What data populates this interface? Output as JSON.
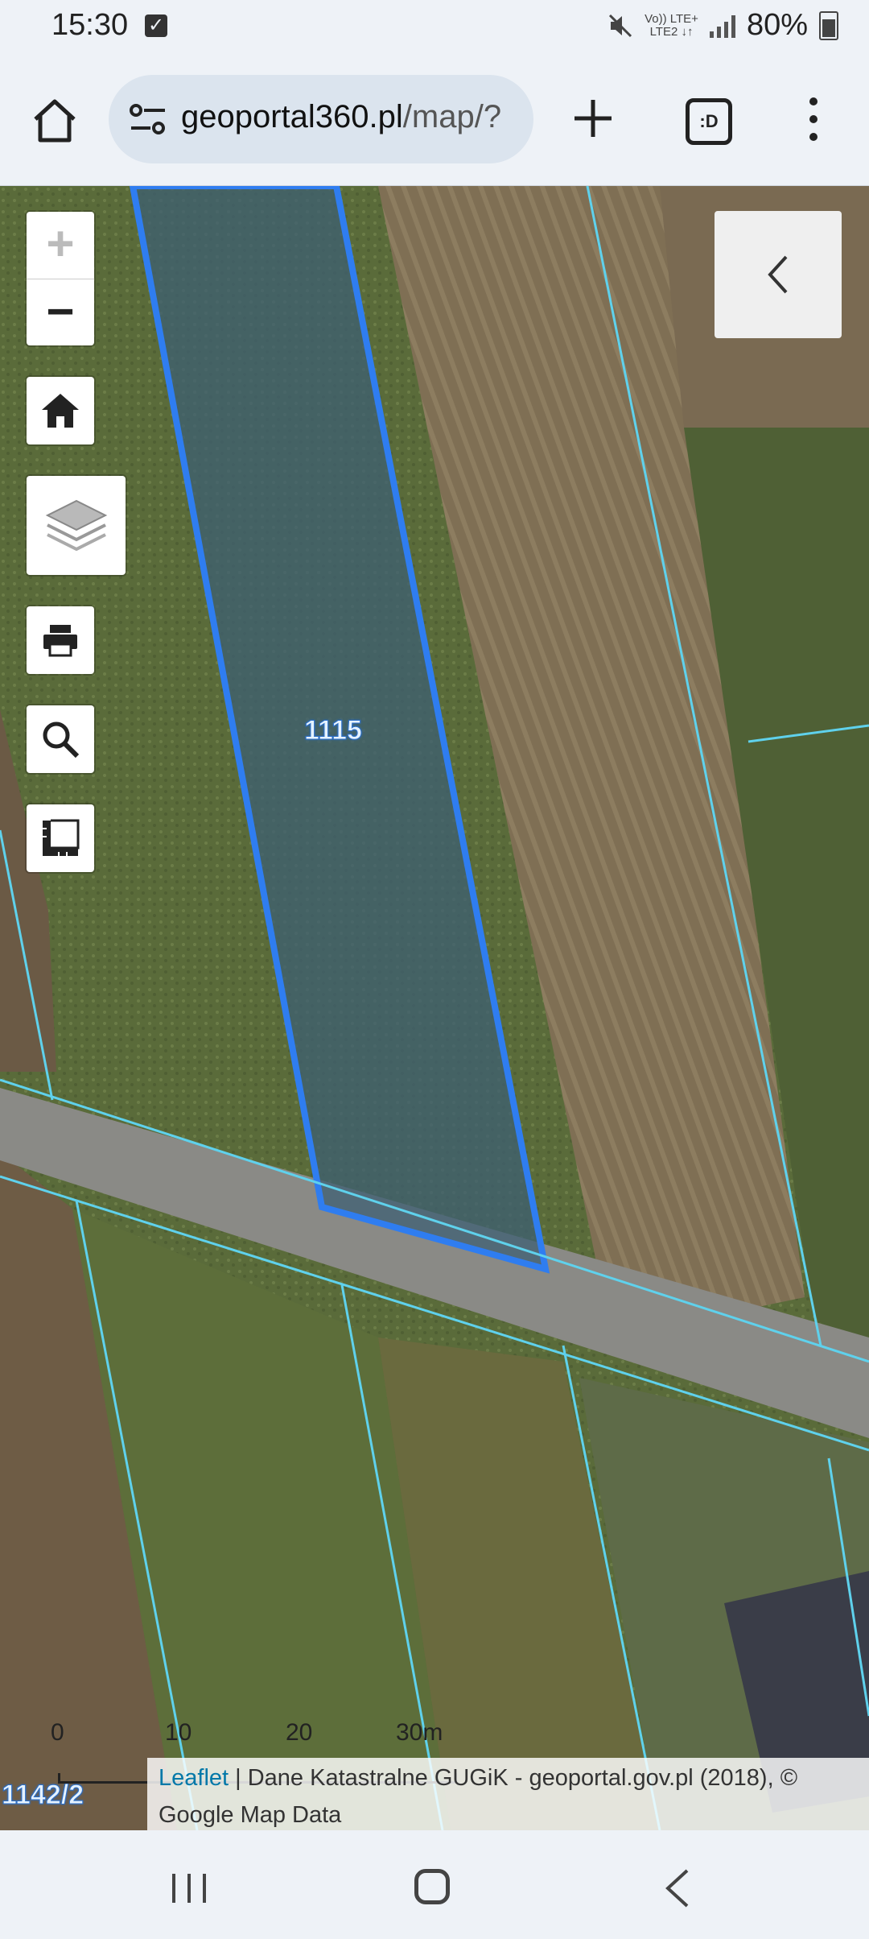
{
  "status": {
    "time": "15:30",
    "network_top": "Vo)) LTE+",
    "network_bottom": "LTE2 ↓↑",
    "battery": "80%"
  },
  "browser": {
    "url_domain": "geoportal360.pl",
    "url_path": "/map/?",
    "tabs_label": ":D"
  },
  "map": {
    "parcel_label": "1115",
    "neighbor_label": "1142/2",
    "zoom_in": "+",
    "zoom_out": "−",
    "scale": {
      "l0": "0",
      "l1": "10",
      "l2": "20",
      "l3": "30m"
    },
    "attribution": {
      "leaflet": "Leaflet",
      "text": " | Dane Katastralne GUGiK - geoportal.gov.pl (2018), © Google Map Data"
    }
  },
  "icons": {
    "home": "home-icon",
    "layers": "layers-icon",
    "print": "print-icon",
    "search": "search-icon",
    "measure": "ruler-icon",
    "collapse": "chevron-left-icon"
  },
  "colors": {
    "parcel_outline": "#2f7df0",
    "parcel_lines": "#5fd1ec"
  }
}
